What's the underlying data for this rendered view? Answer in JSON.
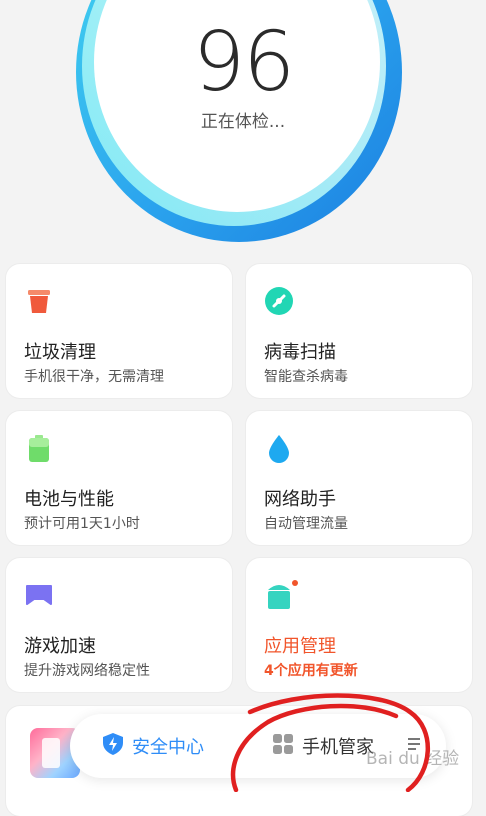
{
  "scan": {
    "score": "96",
    "status": "正在体检..."
  },
  "cards": [
    {
      "id": "cleanup",
      "icon": "trash-icon",
      "title": "垃圾清理",
      "subtitle": "手机很干净，无需清理",
      "accent": "#f05a3c"
    },
    {
      "id": "virus",
      "icon": "virus-scan-icon",
      "title": "病毒扫描",
      "subtitle": "智能查杀病毒",
      "accent": "#21d6b4"
    },
    {
      "id": "battery",
      "icon": "battery-icon",
      "title": "电池与性能",
      "subtitle": "预计可用1天1小时",
      "accent": "#6fdc6a"
    },
    {
      "id": "network",
      "icon": "water-drop-icon",
      "title": "网络助手",
      "subtitle": "自动管理流量",
      "accent": "#1ea9f0"
    },
    {
      "id": "game",
      "icon": "game-boost-icon",
      "title": "游戏加速",
      "subtitle": "提升游戏网络稳定性",
      "accent": "#7b72f2"
    },
    {
      "id": "apps",
      "icon": "android-app-icon",
      "title": "应用管理",
      "subtitle": "4个应用有更新",
      "accent": "#35d4c0",
      "alert_color": "#f1552b"
    }
  ],
  "tabs": {
    "security": "安全中心",
    "manager": "手机管家"
  },
  "watermark": "Bai du 经验",
  "colors": {
    "ring_outer": "#1b8fe8",
    "ring_inner": "#7fe7f0",
    "accent_blue": "#2f8df7",
    "annotation_red": "#e02020"
  }
}
